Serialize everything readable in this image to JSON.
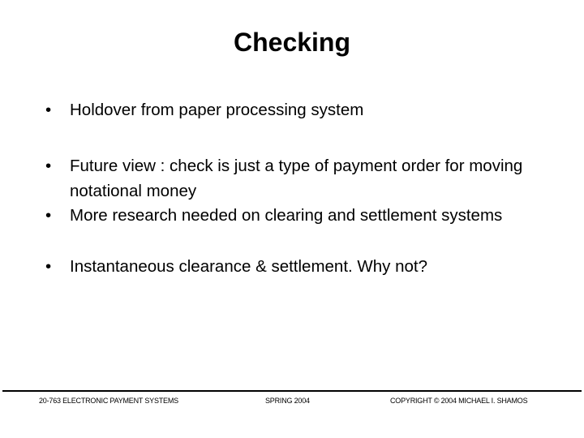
{
  "slide": {
    "title": "Checking",
    "bullets": [
      {
        "marker": "•",
        "text": "Holdover from paper processing system"
      },
      {
        "marker": "•",
        "text": "Future view : check is just a type of payment order for moving notational money"
      },
      {
        "marker": "•",
        "text": "More research needed on clearing and settlement systems"
      },
      {
        "marker": "•",
        "text": "Instantaneous clearance & settlement.  Why not?"
      }
    ]
  },
  "footer": {
    "course": "20-763 ELECTRONIC PAYMENT SYSTEMS",
    "term": "SPRING 2004",
    "copyright": "COPYRIGHT © 2004 MICHAEL I. SHAMOS"
  }
}
